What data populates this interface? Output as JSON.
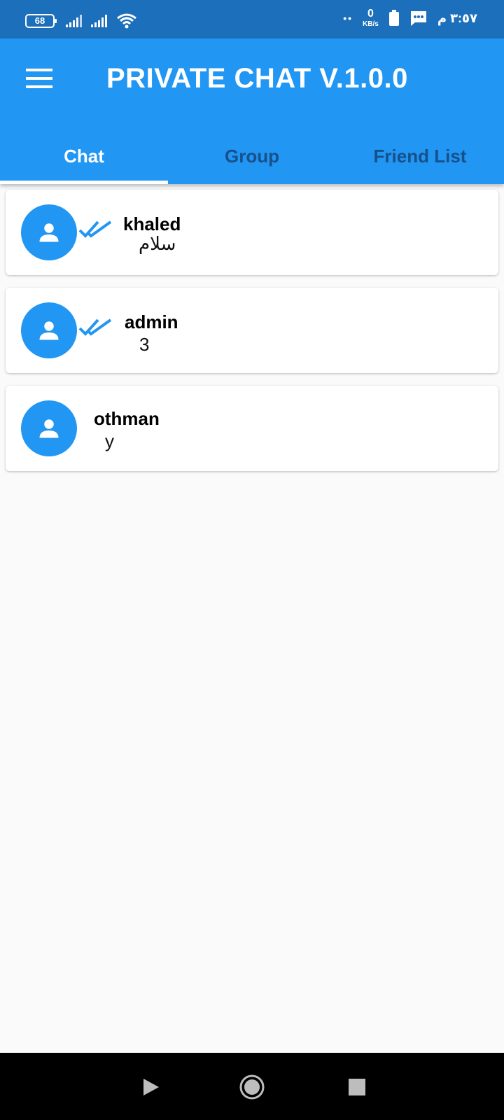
{
  "status_bar": {
    "battery_level": "68",
    "netspeed_value": "0",
    "netspeed_unit": "KB/s",
    "dots": "••",
    "time": "٣:٥٧ م",
    "icons": [
      "battery-icon",
      "signal-icon",
      "signal-icon",
      "wifi-icon",
      "battery-saver-icon",
      "message-icon"
    ]
  },
  "app_bar": {
    "menu_icon": "hamburger-menu-icon",
    "title": "PRIVATE CHAT V.1.0.0",
    "accent_color": "#2196f3"
  },
  "tabs": [
    {
      "label": "Chat",
      "active": true
    },
    {
      "label": "Group",
      "active": false
    },
    {
      "label": "Friend List",
      "active": false
    }
  ],
  "chats": [
    {
      "name": "khaled",
      "last_message": "سلام",
      "read_ticks": true,
      "avatar_icon": "person-icon"
    },
    {
      "name": "admin",
      "last_message": "3",
      "read_ticks": true,
      "avatar_icon": "person-icon"
    },
    {
      "name": "othman",
      "last_message": "y",
      "read_ticks": false,
      "avatar_icon": "person-icon"
    }
  ],
  "nav_bar": {
    "icons": [
      "back-icon",
      "home-icon",
      "recents-icon"
    ]
  }
}
